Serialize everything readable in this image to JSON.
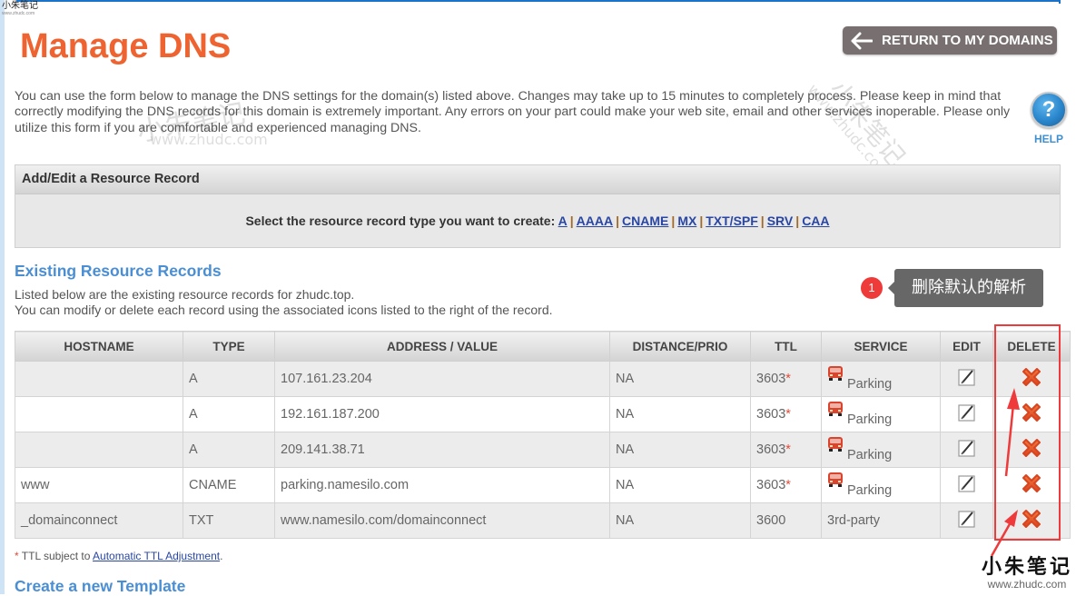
{
  "watermark": {
    "cn": "小朱笔记",
    "url": "www.zhudc.com"
  },
  "header": {
    "title": "Manage DNS",
    "return_button": "RETURN TO MY DOMAINS",
    "help_label": "HELP",
    "help_glyph": "?"
  },
  "intro": "You can use the form below to manage the DNS settings for the domain(s) listed above. Changes may take up to 15 minutes to completely process. Please keep in mind that correctly modifying the DNS records for this domain is extremely important. Any errors on your part could make your web site, email and other services inoperable. Please only utilize this form if you are comfortable and experienced managing DNS.",
  "add_panel": {
    "title": "Add/Edit a Resource Record",
    "prompt": "Select the resource record type you want to create:",
    "types": [
      "A",
      "AAAA",
      "CNAME",
      "MX",
      "TXT/SPF",
      "SRV",
      "CAA"
    ]
  },
  "existing": {
    "title": "Existing Resource Records",
    "desc_line1": "Listed below are the existing resource records for zhudc.top.",
    "desc_line2": "You can modify or delete each record using the associated icons listed to the right of the record."
  },
  "annotation": {
    "badge": "1",
    "text": "删除默认的解析"
  },
  "table": {
    "headers": [
      "HOSTNAME",
      "TYPE",
      "ADDRESS / VALUE",
      "DISTANCE/PRIO",
      "TTL",
      "SERVICE",
      "EDIT",
      "DELETE"
    ],
    "rows": [
      {
        "hostname": "",
        "type": "A",
        "value": "107.161.23.204",
        "prio": "NA",
        "ttl": "3603",
        "ttl_star": "*",
        "service": "Parking",
        "service_icon": "truck-icon"
      },
      {
        "hostname": "",
        "type": "A",
        "value": "192.161.187.200",
        "prio": "NA",
        "ttl": "3603",
        "ttl_star": "*",
        "service": "Parking",
        "service_icon": "truck-icon"
      },
      {
        "hostname": "",
        "type": "A",
        "value": "209.141.38.71",
        "prio": "NA",
        "ttl": "3603",
        "ttl_star": "*",
        "service": "Parking",
        "service_icon": "truck-icon"
      },
      {
        "hostname": "www",
        "type": "CNAME",
        "value": "parking.namesilo.com",
        "prio": "NA",
        "ttl": "3603",
        "ttl_star": "*",
        "service": "Parking",
        "service_icon": "truck-icon"
      },
      {
        "hostname": "_domainconnect",
        "type": "TXT",
        "value": "www.namesilo.com/domainconnect",
        "prio": "NA",
        "ttl": "3600",
        "ttl_star": "",
        "service": "3rd-party",
        "service_icon": ""
      }
    ]
  },
  "footnote": {
    "star": "*",
    "text": " TTL subject to ",
    "link": "Automatic TTL Adjustment",
    "end": "."
  },
  "template_section": {
    "title": "Create a new Template"
  },
  "colors": {
    "title_orange": "#ee6330",
    "link_blue": "#2946a3",
    "section_blue": "#4a8ed3",
    "annotation_red": "#ee3a3a",
    "delete_orange": "#e8582a"
  }
}
